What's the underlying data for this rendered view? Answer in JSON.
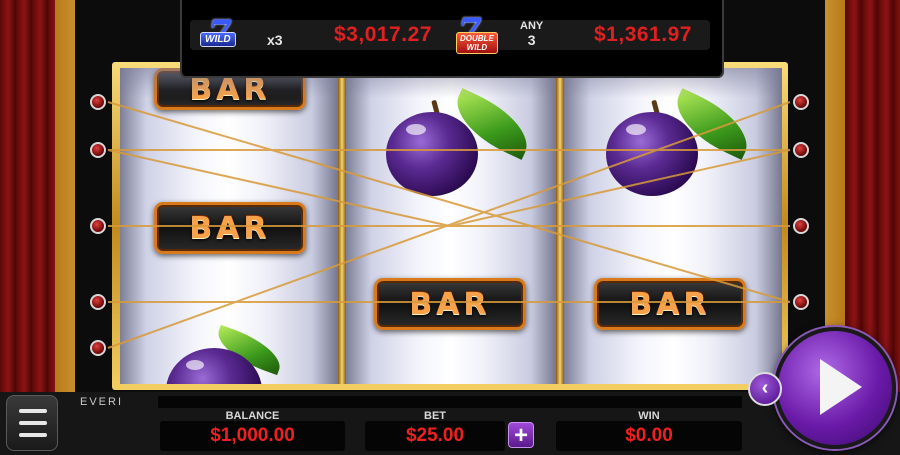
{
  "jackpots": [
    {
      "multiplier": "x3",
      "amount": "$3,017.27",
      "logo_seven": "7",
      "logo_tag": "WILD"
    },
    {
      "condition_top": "ANY",
      "condition_bottom": "3",
      "amount": "$1,361.97",
      "logo_seven": "7",
      "logo_tag_line1": "DOUBLE",
      "logo_tag_line2": "WILD"
    }
  ],
  "reels": [
    [
      "BAR",
      "BAR",
      "plum"
    ],
    [
      "plum",
      "BAR"
    ],
    [
      "plum",
      "BAR"
    ]
  ],
  "symbols": {
    "bar_label": "BAR"
  },
  "brand": "EVERI",
  "meters": {
    "balance_label": "BALANCE",
    "balance_value": "$1,000.00",
    "bet_label": "BET",
    "bet_value": "$25.00",
    "win_label": "WIN",
    "win_value": "$0.00"
  },
  "controls": {
    "plus": "+",
    "back": "‹"
  },
  "colors": {
    "meter_value": "#f02020",
    "jackpot_value": "#e02020",
    "spin_button": "#8a3ad0"
  }
}
